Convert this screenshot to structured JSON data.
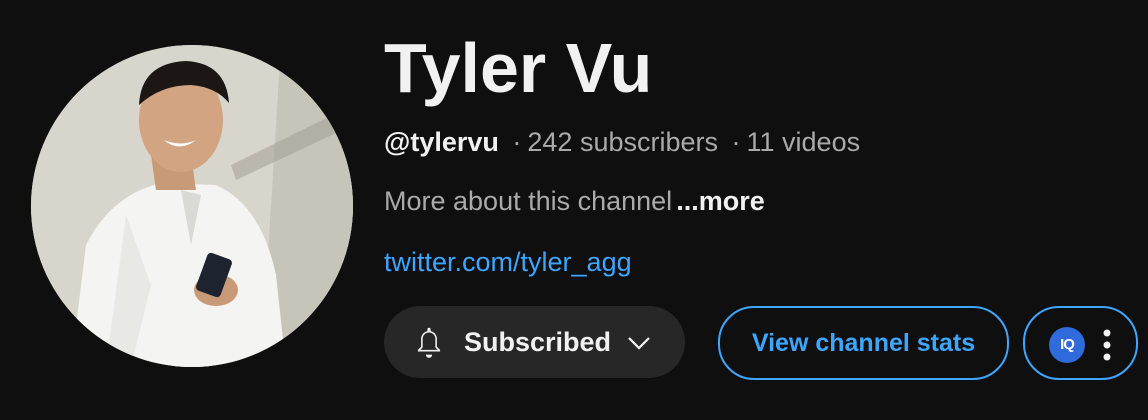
{
  "channel": {
    "name": "Tyler Vu",
    "handle": "@tylervu",
    "separator": "·",
    "subscribers": "242 subscribers",
    "videos": "11 videos",
    "description": "More about this channel",
    "more_label": "...more",
    "link_text": "twitter.com/tyler_agg"
  },
  "actions": {
    "subscribed_label": "Subscribed",
    "view_stats_label": "View channel stats",
    "extension_logo_text": "IQ"
  },
  "icons": {
    "bell": "bell-icon",
    "chevron": "chevron-down-icon",
    "more": "more-vert-icon",
    "extension": "extension-logo-icon"
  },
  "colors": {
    "background": "#0f0f0f",
    "primary_text": "#f1f1f1",
    "secondary_text": "#aaaaaa",
    "link": "#3ea6ff",
    "button_bg": "#272727",
    "extension_logo_bg": "#2f6bdc"
  }
}
